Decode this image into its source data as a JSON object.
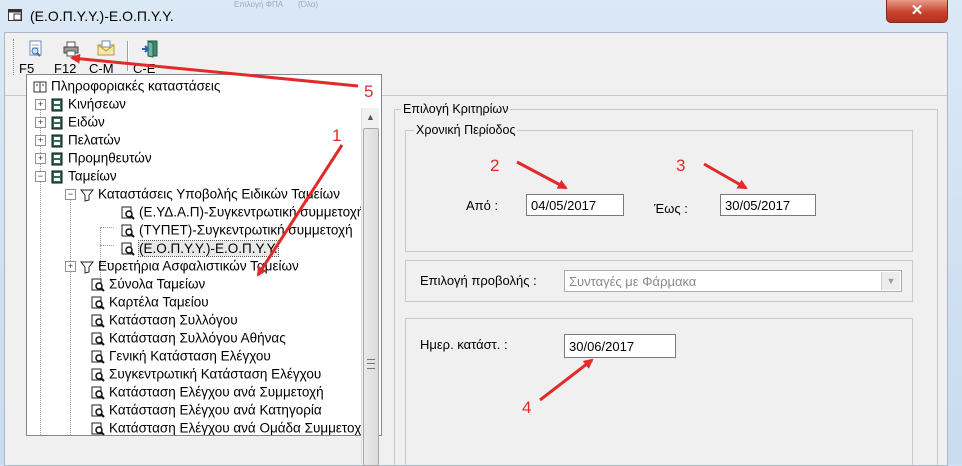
{
  "window": {
    "title": "(Ε.Ο.Π.Υ.Υ.)-Ε.Ο.Π.Υ.Υ.",
    "close_label": "✕",
    "background_title_left": "Επιλογή ΦΠΑ",
    "background_title_right": "(Όλα)"
  },
  "toolbar": {
    "buttons": [
      {
        "label": "F5",
        "icon": "preview-icon"
      },
      {
        "label": "F12",
        "icon": "print-icon"
      },
      {
        "label": "C-M",
        "icon": "email-icon"
      },
      {
        "label": "C-E",
        "icon": "exit-icon"
      }
    ]
  },
  "tree": {
    "root": "Πληροφοριακές καταστάσεις",
    "items": [
      {
        "label": "Κινήσεων"
      },
      {
        "label": "Ειδών"
      },
      {
        "label": "Πελατών"
      },
      {
        "label": "Προμηθευτών"
      },
      {
        "label": "Ταμείων"
      },
      {
        "label": "Καταστάσεις Υποβολής Ειδικών Ταμείων"
      },
      {
        "label": "(Ε.ΥΔ.Α.Π)-Συγκεντρωτική συμμετοχή"
      },
      {
        "label": "(ΤΥΠΕΤ)-Συγκεντρωτική συμμετοχή"
      },
      {
        "label": "(Ε.Ο.Π.Υ.Υ.)-Ε.Ο.Π.Υ.Υ."
      },
      {
        "label": "Ευρετήρια Ασφαλιστικών Ταμείων"
      },
      {
        "label": "Σύνολα Ταμείων"
      },
      {
        "label": "Καρτέλα Ταμείου"
      },
      {
        "label": "Κατάσταση Συλλόγου"
      },
      {
        "label": "Κατάσταση Συλλόγου Αθήνας"
      },
      {
        "label": "Γενική Κατάσταση Ελέγχου"
      },
      {
        "label": "Συγκεντρωτική Κατάσταση Ελέγχου"
      },
      {
        "label": "Κατάσταση Ελέγχου ανά Συμμετοχή"
      },
      {
        "label": "Κατάσταση Ελέγχου ανά Κατηγορία"
      },
      {
        "label": "Κατάσταση Ελέγχου ανά Ομάδα Συμμετοχής"
      }
    ]
  },
  "criteria": {
    "group_title": "Επιλογή Κριτηρίων",
    "period_title": "Χρονική Περίοδος",
    "from_label": "Από :",
    "from_value": "04/05/2017",
    "to_label": "Έως :",
    "to_value": "30/05/2017",
    "view_label": "Επιλογή προβολής :",
    "view_value": "Συνταγές με Φάρμακα",
    "date_label": "Ημερ. κατάστ. :",
    "date_value": "30/06/2017"
  },
  "annotations": {
    "n1": "1",
    "n2": "2",
    "n3": "3",
    "n4": "4",
    "n5": "5",
    "color": "#e22a2a"
  }
}
